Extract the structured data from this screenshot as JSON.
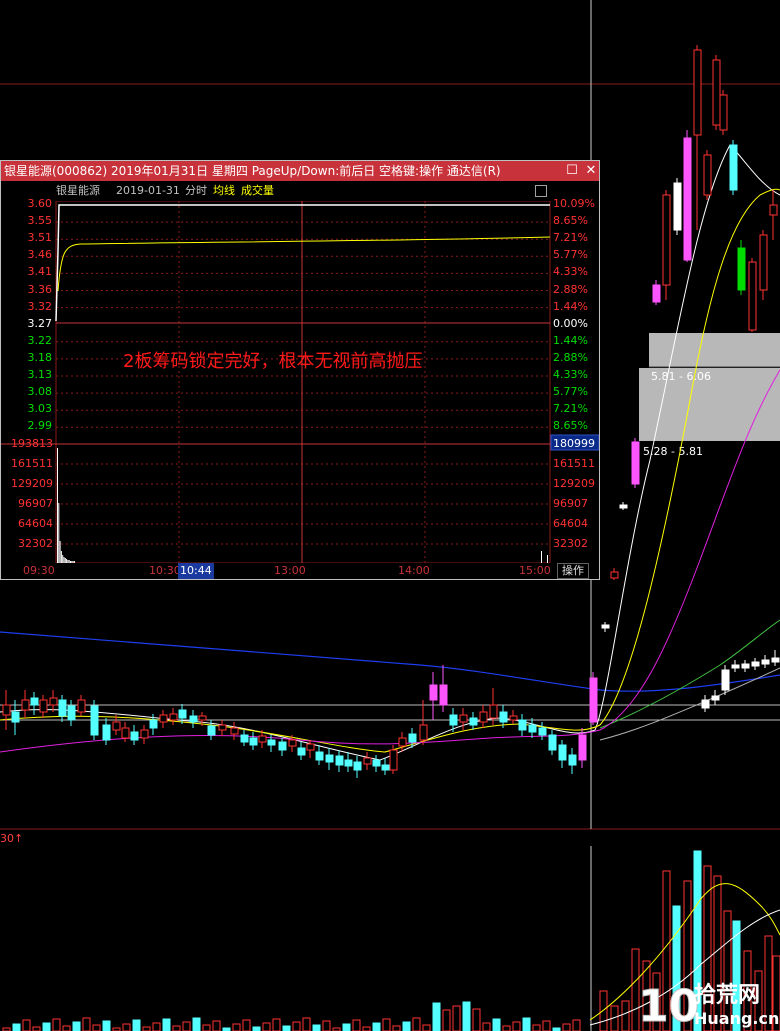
{
  "background_chart": {
    "gap_zone_upper_label": "5.81 - 6.06",
    "gap_zone_lower_label": "5.28 - 5.81",
    "volume_indicator_label": "30↑"
  },
  "popup": {
    "title": "银星能源(000862) 2019年01月31日 星期四 PageUp/Down:前后日 空格键:操作 通达信(R)",
    "restore_symbol": "☐",
    "close_symbol": "✕",
    "stock_name": "银星能源",
    "date": "2019-01-31",
    "view_mode": "分时",
    "avg_line_label": "均线",
    "volume_label": "成交量",
    "annotation": "2板筹码锁定完好，根本无视前高抛压",
    "price_labels": [
      "3.60",
      "3.55",
      "3.51",
      "3.46",
      "3.41",
      "3.36",
      "3.32",
      "3.27",
      "3.22",
      "3.18",
      "3.13",
      "3.08",
      "3.03",
      "2.99"
    ],
    "pct_labels": [
      "10.09%",
      "8.65%",
      "7.21%",
      "5.77%",
      "4.33%",
      "2.88%",
      "1.44%",
      "0.00%",
      "1.44%",
      "2.88%",
      "4.33%",
      "5.77%",
      "7.21%",
      "8.65%"
    ],
    "volume_labels_left": [
      "193813",
      "161511",
      "129209",
      "96907",
      "64604",
      "32302"
    ],
    "volume_labels_right": [
      "180999",
      "161511",
      "129209",
      "96907",
      "64604",
      "32302"
    ],
    "time_labels": [
      "09:30",
      "10:30",
      "10:44",
      "13:00",
      "14:00",
      "15:00"
    ],
    "operate_label": "操作"
  },
  "logo": {
    "digits": "10",
    "name": "拾荒网",
    "domain": "Huang.cn"
  },
  "colors": {
    "up": "#ff3232",
    "down": "#54ffff",
    "pink_candle": "#ff55ff",
    "green_candle": "#00dd00",
    "grid": "#8b1a1a",
    "price_line": "#ffffff",
    "avg_line": "#ffff00",
    "ma_blue": "#1e3ef0",
    "ma_magenta": "#e020e0",
    "ma_green": "#40c040",
    "title_bar": "#c8323a"
  }
}
